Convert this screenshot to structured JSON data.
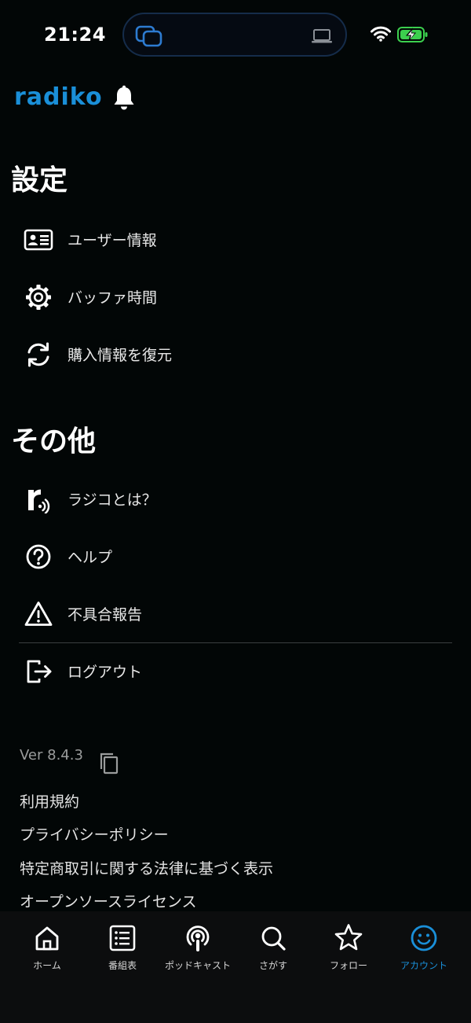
{
  "status_bar": {
    "time": "21:24"
  },
  "header": {
    "logo": "radiko"
  },
  "settings": {
    "title": "設定",
    "items": [
      {
        "label": "ユーザー情報",
        "icon": "id-card-icon"
      },
      {
        "label": "バッファ時間",
        "icon": "gear-icon"
      },
      {
        "label": "購入情報を復元",
        "icon": "refresh-icon"
      }
    ]
  },
  "other": {
    "title": "その他",
    "items": [
      {
        "label": "ラジコとは？",
        "icon": "radiko-r-icon"
      },
      {
        "label": "ヘルプ",
        "icon": "help-icon"
      },
      {
        "label": "不具合報告",
        "icon": "warning-icon"
      },
      {
        "label": "ログアウト",
        "icon": "logout-icon"
      }
    ]
  },
  "footer": {
    "version": "Ver 8.4.3",
    "links": [
      "利用規約",
      "プライバシーポリシー",
      "特定商取引に関する法律に基づく表示",
      "オープンソースライセンス"
    ]
  },
  "tab_bar": {
    "tabs": [
      {
        "label": "ホーム",
        "icon": "home-icon",
        "active": false
      },
      {
        "label": "番組表",
        "icon": "program-list-icon",
        "active": false
      },
      {
        "label": "ポッドキャスト",
        "icon": "podcast-icon",
        "active": false
      },
      {
        "label": "さがす",
        "icon": "search-icon",
        "active": false
      },
      {
        "label": "フォロー",
        "icon": "star-icon",
        "active": false
      },
      {
        "label": "アカウント",
        "icon": "account-smile-icon",
        "active": true
      }
    ]
  },
  "colors": {
    "accent": "#1a8fd8",
    "background": "#020606",
    "battery": "#3ccf4e"
  }
}
